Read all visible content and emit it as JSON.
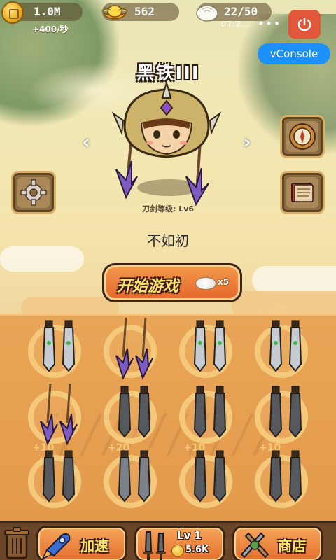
{
  "hud": {
    "coins": "1.0M",
    "coin_rate": "+400/秒",
    "ingots": "562",
    "energy": "22/50",
    "status_time": "07:2…",
    "status_dots": "•••"
  },
  "vconsole_label": "vConsole",
  "hero": {
    "rank_title": "黑铁III",
    "sword_level": "刀剑等级: Lv6",
    "player_name": "不如初",
    "prev_arrow": "‹",
    "next_arrow": "›"
  },
  "start_button": {
    "label": "开始游戏",
    "cost": "x5"
  },
  "board": {
    "top_bonus": "+160",
    "slots": [
      {
        "weapon": "jade-dagger",
        "bonus": ""
      },
      {
        "weapon": "purple-spear",
        "bonus": ""
      },
      {
        "weapon": "jade-dagger",
        "bonus": ""
      },
      {
        "weapon": "jade-dagger",
        "bonus": ""
      },
      {
        "weapon": "purple-spear",
        "bonus": "+10"
      },
      {
        "weapon": "iron-sword",
        "bonus": "+20"
      },
      {
        "weapon": "iron-sword",
        "bonus": "+10"
      },
      {
        "weapon": "iron-sword",
        "bonus": "+10"
      },
      {
        "weapon": "iron-sword",
        "bonus": ""
      },
      {
        "weapon": "steel-sword",
        "bonus": ""
      },
      {
        "weapon": "iron-sword",
        "bonus": ""
      },
      {
        "weapon": "iron-sword",
        "bonus": ""
      }
    ]
  },
  "bottom_bar": {
    "speed_label": "加速",
    "buy_level": "Lv 1",
    "buy_price": "5.6K",
    "shop_label": "商店"
  },
  "icons": {
    "coin": "coin-icon",
    "ingot": "gold-ingot-icon",
    "energy": "steamed-bun-icon",
    "power": "power-icon",
    "settings": "gear-icon",
    "compass": "compass-icon",
    "book": "book-icon",
    "trash": "trash-icon"
  },
  "colors": {
    "accent_orange": "#e5652a",
    "board_orange": "#e9a557",
    "slot_ring": "#f4c97b",
    "vconsole_blue": "#1c90ff",
    "power_red": "#e2563a"
  }
}
